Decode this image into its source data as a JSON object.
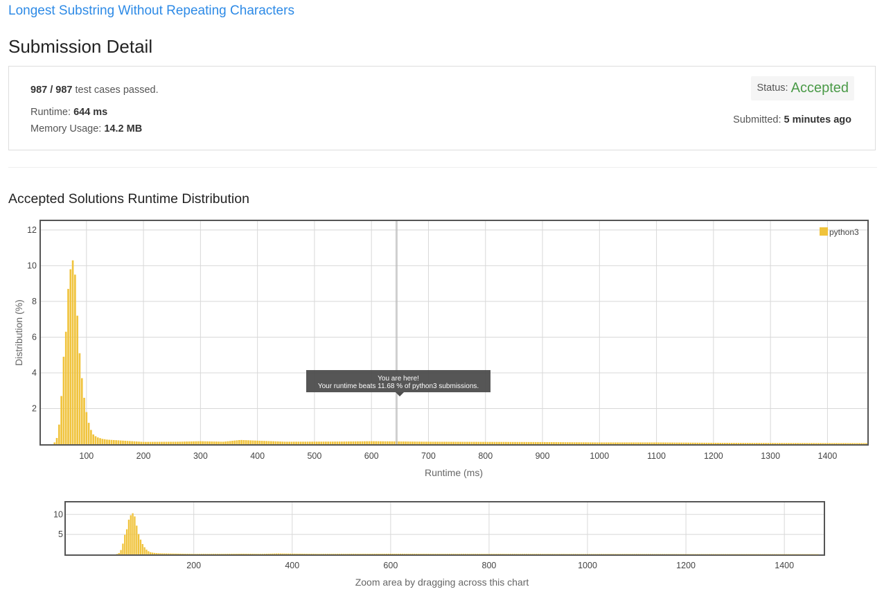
{
  "problem_title": "Longest Substring Without Repeating Characters",
  "page_title": "Submission Detail",
  "summary": {
    "cases_passed": "987 / 987",
    "cases_suffix": " test cases passed.",
    "runtime_label": "Runtime: ",
    "runtime_value": "644 ms",
    "memory_label": "Memory Usage: ",
    "memory_value": "14.2 MB",
    "status_label": "Status: ",
    "status_value": "Accepted",
    "submitted_label": "Submitted: ",
    "submitted_value": "5 minutes ago"
  },
  "section_title": "Accepted Solutions Runtime Distribution",
  "colors": {
    "bar": "#f0c33c",
    "accent_link": "#2d8ae6",
    "accepted": "#4a9a47"
  },
  "tooltip": {
    "line1": "You are here!",
    "line2": "Your runtime beats 11.68 % of python3 submissions."
  },
  "zoom_hint": "Zoom area by dragging across this chart",
  "chart_data": [
    {
      "type": "bar",
      "name": "main",
      "series": [
        {
          "name": "python3",
          "color": "#f0c33c"
        }
      ],
      "xlabel": "Runtime (ms)",
      "ylabel": "Distribution (%)",
      "xlim": [
        20,
        1470
      ],
      "ylim": [
        0,
        12.5
      ],
      "x_ticks": [
        100,
        200,
        300,
        400,
        500,
        600,
        700,
        800,
        900,
        1000,
        1100,
        1200,
        1300,
        1400
      ],
      "y_ticks": [
        2,
        4,
        6,
        8,
        10,
        12
      ],
      "grid": true,
      "legend": "top-right",
      "marker_x": 644,
      "peak": [
        [
          44,
          0.1
        ],
        [
          48,
          0.35
        ],
        [
          52,
          1.1
        ],
        [
          56,
          2.7
        ],
        [
          60,
          4.9
        ],
        [
          64,
          6.3
        ],
        [
          68,
          8.7
        ],
        [
          72,
          9.8
        ],
        [
          76,
          10.3
        ],
        [
          80,
          9.5
        ],
        [
          84,
          7.2
        ],
        [
          88,
          5.1
        ],
        [
          92,
          3.7
        ],
        [
          96,
          2.6
        ],
        [
          100,
          1.8
        ],
        [
          104,
          1.2
        ],
        [
          108,
          0.8
        ],
        [
          112,
          0.55
        ],
        [
          116,
          0.45
        ],
        [
          120,
          0.38
        ],
        [
          124,
          0.34
        ],
        [
          128,
          0.3
        ],
        [
          132,
          0.28
        ],
        [
          136,
          0.26
        ],
        [
          140,
          0.25
        ]
      ],
      "tail_profile": [
        [
          140,
          0.25
        ],
        [
          200,
          0.13
        ],
        [
          260,
          0.14
        ],
        [
          300,
          0.17
        ],
        [
          340,
          0.14
        ],
        [
          370,
          0.24
        ],
        [
          400,
          0.2
        ],
        [
          450,
          0.14
        ],
        [
          550,
          0.15
        ],
        [
          600,
          0.17
        ],
        [
          700,
          0.14
        ],
        [
          800,
          0.13
        ],
        [
          900,
          0.12
        ],
        [
          1000,
          0.1
        ],
        [
          1100,
          0.1
        ],
        [
          1200,
          0.08
        ],
        [
          1300,
          0.07
        ],
        [
          1470,
          0.06
        ]
      ]
    },
    {
      "type": "bar",
      "name": "navigator",
      "xlim": [
        -60,
        1480
      ],
      "ylim": [
        0,
        13
      ],
      "x_ticks": [
        200,
        400,
        600,
        800,
        1000,
        1200,
        1400
      ],
      "y_ticks": [
        5,
        10
      ]
    }
  ]
}
